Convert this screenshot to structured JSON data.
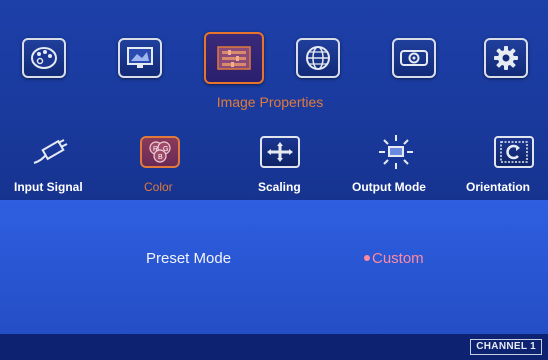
{
  "top_menu": {
    "selected_label": "Image Properties",
    "icons": [
      {
        "name": "palette-icon"
      },
      {
        "name": "monitor-icon"
      },
      {
        "name": "image-properties-icon"
      },
      {
        "name": "globe-icon"
      },
      {
        "name": "projector-icon"
      },
      {
        "name": "gear-icon"
      }
    ]
  },
  "sub_menu": {
    "items": [
      {
        "label": "Input Signal",
        "icon": "cable-plug-icon"
      },
      {
        "label": "Color",
        "icon": "rgb-circles-icon",
        "active": true
      },
      {
        "label": "Scaling",
        "icon": "scaling-arrows-icon"
      },
      {
        "label": "Output Mode",
        "icon": "output-display-icon"
      },
      {
        "label": "Orientation",
        "icon": "rotate-frame-icon"
      }
    ]
  },
  "content": {
    "preset_mode_label": "Preset Mode",
    "preset_mode_value": "Custom"
  },
  "status": {
    "channel": "CHANNEL 1"
  },
  "colors": {
    "accent": "#e07a3a",
    "value": "#ff8aa0",
    "background": "#1c3fa8",
    "panel": "#2f5fe0"
  }
}
